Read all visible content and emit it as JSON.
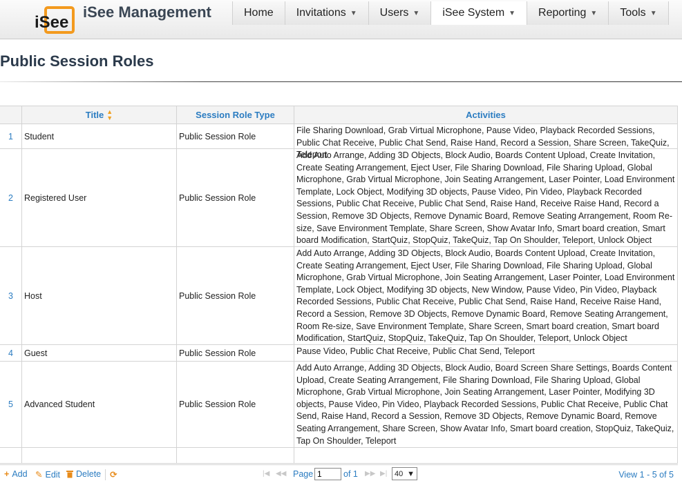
{
  "header": {
    "logo_text": "iSee",
    "app_title": "iSee Management",
    "nav": [
      {
        "label": "Home",
        "has_caret": false
      },
      {
        "label": "Invitations",
        "has_caret": true
      },
      {
        "label": "Users",
        "has_caret": true
      },
      {
        "label": "iSee System",
        "has_caret": true,
        "active": true
      },
      {
        "label": "Reporting",
        "has_caret": true
      },
      {
        "label": "Tools",
        "has_caret": true
      }
    ],
    "caret_glyph": "▼"
  },
  "page": {
    "title": "Public Session Roles"
  },
  "grid": {
    "columns": {
      "title": "Title",
      "type": "Session Role Type",
      "activities": "Activities"
    },
    "sort_icon": "sort-arrows-icon",
    "rows": [
      {
        "num": "1",
        "title": "Student",
        "type": "Public Session Role",
        "activities": "File Sharing Download, Grab Virtual Microphone, Pause Video, Playback Recorded Sessions, Public Chat Receive, Public Chat Send, Raise Hand, Record a Session, Share Screen, TakeQuiz, Teleport"
      },
      {
        "num": "2",
        "title": "Registered User",
        "type": "Public Session Role",
        "activities": "Add Auto Arrange, Adding 3D Objects, Block Audio, Boards Content Upload, Create Invitation, Create Seating Arrangement, Eject User, File Sharing Download, File Sharing Upload, Global Microphone, Grab Virtual Microphone, Join Seating Arrangement, Laser Pointer, Load Environment Template, Lock Object, Modifying 3D objects, Pause Video, Pin Video, Playback Recorded Sessions, Public Chat Receive, Public Chat Send, Raise Hand, Receive Raise Hand, Record a Session, Remove 3D Objects, Remove Dynamic Board, Remove Seating Arrangement, Room Re-size, Save Environment Template, Share Screen, Show Avatar Info, Smart board creation, Smart board Modification, StartQuiz, StopQuiz, TakeQuiz, Tap On Shoulder, Teleport, Unlock Object"
      },
      {
        "num": "3",
        "title": "Host",
        "type": "Public Session Role",
        "activities": "Add Auto Arrange, Adding 3D Objects, Block Audio, Boards Content Upload, Create Invitation, Create Seating Arrangement, Eject User, File Sharing Download, File Sharing Upload, Global Microphone, Grab Virtual Microphone, Join Seating Arrangement, Laser Pointer, Load Environment Template, Lock Object, Modifying 3D objects, New Window, Pause Video, Pin Video, Playback Recorded Sessions, Public Chat Receive, Public Chat Send, Raise Hand, Receive Raise Hand, Record a Session, Remove 3D Objects, Remove Dynamic Board, Remove Seating Arrangement, Room Re-size, Save Environment Template, Share Screen, Smart board creation, Smart board Modification, StartQuiz, StopQuiz, TakeQuiz, Tap On Shoulder, Teleport, Unlock Object"
      },
      {
        "num": "4",
        "title": "Guest",
        "type": "Public Session Role",
        "activities": "Pause Video, Public Chat Receive, Public Chat Send, Teleport"
      },
      {
        "num": "5",
        "title": "Advanced Student",
        "type": "Public Session Role",
        "activities": "Add Auto Arrange, Adding 3D Objects, Block Audio, Board Screen Share Settings, Boards Content Upload, Create Seating Arrangement, File Sharing Download, File Sharing Upload, Global Microphone, Grab Virtual Microphone, Join Seating Arrangement, Laser Pointer, Modifying 3D objects, Pause Video, Pin Video, Playback Recorded Sessions, Public Chat Receive, Public Chat Send, Raise Hand, Record a Session, Remove 3D Objects, Remove Dynamic Board, Remove Seating Arrangement, Share Screen, Show Avatar Info, Smart board creation, StopQuiz, TakeQuiz, Tap On Shoulder, Teleport"
      }
    ]
  },
  "pager": {
    "add_label": "Add",
    "edit_label": "Edit",
    "delete_label": "Delete",
    "page_label": "Page",
    "page_value": "1",
    "of_label": "of 1",
    "page_size": "40",
    "view_count": "View 1 - 5 of 5"
  },
  "colors": {
    "accent": "#2b7cc1",
    "icon_orange": "#e88b1a"
  }
}
